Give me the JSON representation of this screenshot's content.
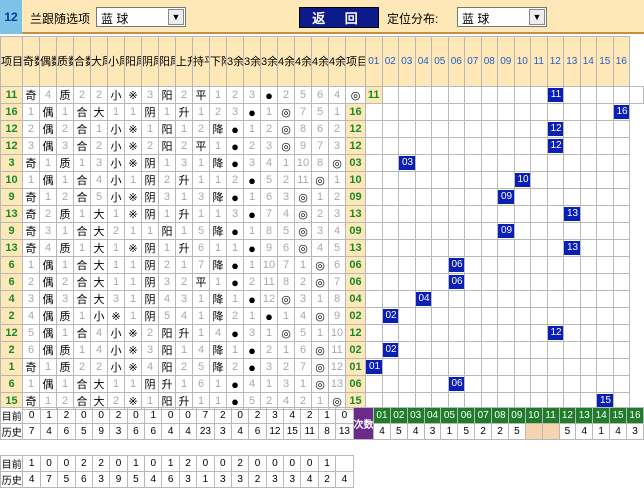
{
  "topbar": {
    "current_number": "12",
    "blue_select_label": "兰跟随选项",
    "blue_select_value": "蓝      球",
    "back_label": "返  回",
    "position_label": "定位分布:",
    "position_value": "蓝      球"
  },
  "left_headers": [
    "项目",
    "奇数",
    "偶数",
    "质数",
    "合数",
    "大尾",
    "小尾",
    "阳尾",
    "阴尾",
    "阳尾",
    "上升",
    "持平",
    "下降",
    "3余0",
    "3余1",
    "3余2",
    "4余0",
    "4余1",
    "4余2",
    "4余3",
    "项目"
  ],
  "right_headers": [
    "01",
    "02",
    "03",
    "04",
    "05",
    "06",
    "07",
    "08",
    "09",
    "10",
    "11",
    "12",
    "13",
    "14",
    "15",
    "16"
  ],
  "rows": [
    {
      "id": "11",
      "left": [
        "奇",
        "4",
        "质",
        "2",
        "2",
        "小",
        "※",
        "3",
        "阳",
        "2",
        "平",
        "1",
        "2",
        "3",
        "●",
        "2",
        "5",
        "6",
        "4",
        "◎"
      ],
      "ball": 11,
      "right_id": "11"
    },
    {
      "id": "16",
      "left": [
        "1",
        "偶",
        "1",
        "合",
        "大",
        "1",
        "1",
        "阴",
        "1",
        "升",
        "1",
        "2",
        "3",
        "●",
        "1",
        "◎",
        "7",
        "5",
        "1"
      ],
      "ball": 16,
      "right_id": "16"
    },
    {
      "id": "12",
      "left": [
        "2",
        "偶",
        "2",
        "合",
        "1",
        "小",
        "※",
        "1",
        "阳",
        "1",
        "2",
        "降",
        "●",
        "1",
        "2",
        "◎",
        "8",
        "6",
        "2"
      ],
      "ball": 12,
      "right_id": "12"
    },
    {
      "id": "12",
      "left": [
        "3",
        "偶",
        "3",
        "合",
        "2",
        "小",
        "※",
        "2",
        "阳",
        "2",
        "平",
        "1",
        "●",
        "2",
        "3",
        "◎",
        "9",
        "7",
        "3"
      ],
      "ball": 12,
      "right_id": "12"
    },
    {
      "id": "3",
      "left": [
        "奇",
        "1",
        "质",
        "1",
        "3",
        "小",
        "※",
        "阴",
        "1",
        "3",
        "1",
        "降",
        "●",
        "3",
        "4",
        "1",
        "10",
        "8",
        "◎"
      ],
      "ball": 3,
      "right_id": "03"
    },
    {
      "id": "10",
      "left": [
        "1",
        "偶",
        "1",
        "合",
        "4",
        "小",
        "1",
        "阴",
        "2",
        "升",
        "1",
        "1",
        "2",
        "●",
        "5",
        "2",
        "11",
        "◎",
        "1"
      ],
      "ball": 10,
      "right_id": "10"
    },
    {
      "id": "9",
      "left": [
        "奇",
        "1",
        "2",
        "合",
        "5",
        "小",
        "※",
        "阴",
        "3",
        "1",
        "3",
        "降",
        "●",
        "1",
        "6",
        "3",
        "◎",
        "1",
        "2"
      ],
      "ball": 9,
      "right_id": "09"
    },
    {
      "id": "13",
      "left": [
        "奇",
        "2",
        "质",
        "1",
        "大",
        "1",
        "※",
        "阴",
        "1",
        "升",
        "1",
        "1",
        "3",
        "●",
        "7",
        "4",
        "◎",
        "2",
        "3"
      ],
      "ball": 13,
      "right_id": "13"
    },
    {
      "id": "9",
      "left": [
        "奇",
        "3",
        "1",
        "合",
        "大",
        "2",
        "1",
        "1",
        "阳",
        "1",
        "5",
        "降",
        "●",
        "1",
        "8",
        "5",
        "◎",
        "3",
        "4"
      ],
      "ball": 9,
      "right_id": "09"
    },
    {
      "id": "13",
      "left": [
        "奇",
        "4",
        "质",
        "1",
        "大",
        "1",
        "※",
        "阴",
        "1",
        "升",
        "6",
        "1",
        "1",
        "●",
        "9",
        "6",
        "◎",
        "4",
        "5"
      ],
      "ball": 13,
      "right_id": "13"
    },
    {
      "id": "6",
      "left": [
        "1",
        "偶",
        "1",
        "合",
        "大",
        "1",
        "1",
        "阴",
        "2",
        "1",
        "7",
        "降",
        "●",
        "1",
        "10",
        "7",
        "1",
        "◎",
        "6"
      ],
      "ball": 6,
      "right_id": "06"
    },
    {
      "id": "6",
      "left": [
        "2",
        "偶",
        "2",
        "合",
        "大",
        "1",
        "1",
        "阴",
        "3",
        "2",
        "平",
        "1",
        "●",
        "2",
        "11",
        "8",
        "2",
        "◎",
        "7"
      ],
      "ball": 6,
      "right_id": "06"
    },
    {
      "id": "4",
      "left": [
        "3",
        "偶",
        "3",
        "合",
        "大",
        "3",
        "1",
        "阴",
        "4",
        "3",
        "1",
        "降",
        "1",
        "●",
        "12",
        "◎",
        "3",
        "1",
        "8"
      ],
      "ball": 4,
      "right_id": "04"
    },
    {
      "id": "2",
      "left": [
        "4",
        "偶",
        "质",
        "1",
        "小",
        "※",
        "1",
        "阴",
        "5",
        "4",
        "1",
        "降",
        "2",
        "1",
        "●",
        "1",
        "4",
        "◎",
        "9"
      ],
      "ball": 2,
      "right_id": "02"
    },
    {
      "id": "12",
      "left": [
        "5",
        "偶",
        "1",
        "合",
        "4",
        "小",
        "※",
        "2",
        "阳",
        "升",
        "1",
        "4",
        "●",
        "3",
        "1",
        "◎",
        "5",
        "1",
        "10"
      ],
      "ball": 12,
      "right_id": "12"
    },
    {
      "id": "2",
      "left": [
        "6",
        "偶",
        "质",
        "1",
        "4",
        "小",
        "※",
        "3",
        "阳",
        "1",
        "4",
        "降",
        "1",
        "●",
        "2",
        "1",
        "6",
        "◎",
        "11"
      ],
      "ball": 2,
      "right_id": "02"
    },
    {
      "id": "1",
      "left": [
        "奇",
        "1",
        "质",
        "2",
        "2",
        "小",
        "※",
        "4",
        "阳",
        "2",
        "5",
        "降",
        "2",
        "●",
        "3",
        "2",
        "7",
        "◎",
        "12"
      ],
      "ball": 1,
      "right_id": "01"
    },
    {
      "id": "6",
      "left": [
        "1",
        "偶",
        "1",
        "合",
        "大",
        "1",
        "1",
        "阴",
        "升",
        "1",
        "6",
        "1",
        "●",
        "4",
        "1",
        "3",
        "1",
        "◎",
        "13"
      ],
      "ball": 6,
      "right_id": "06"
    },
    {
      "id": "15",
      "left": [
        "奇",
        "1",
        "2",
        "合",
        "大",
        "2",
        "※",
        "1",
        "阳",
        "升",
        "1",
        "1",
        "●",
        "5",
        "2",
        "4",
        "2",
        "1",
        "◎"
      ],
      "ball": 15,
      "right_id": "15"
    }
  ],
  "footer": {
    "current_label": "目前",
    "history_label": "历史",
    "current_left": [
      "0",
      "1",
      "2",
      "0",
      "0",
      "2",
      "0",
      "1",
      "0",
      "0",
      "7",
      "2",
      "0",
      "2",
      "3",
      "4",
      "2",
      "1",
      "0"
    ],
    "history_left": [
      "7",
      "4",
      "6",
      "5",
      "9",
      "3",
      "6",
      "6",
      "4",
      "4",
      "23",
      "3",
      "4",
      "6",
      "12",
      "15",
      "11",
      "8",
      "13"
    ],
    "times_label": "次数",
    "nums": [
      "01",
      "02",
      "03",
      "04",
      "05",
      "06",
      "07",
      "08",
      "09",
      "10",
      "11",
      "12",
      "13",
      "14",
      "15",
      "16"
    ],
    "counts": [
      "4",
      "5",
      "4",
      "3",
      "1",
      "5",
      "2",
      "2",
      "5",
      "",
      "",
      "5",
      "4",
      "1",
      "4",
      "3"
    ],
    "current2_label": "目前",
    "history2_label": "历史",
    "current2": [
      "1",
      "0",
      "0",
      "2",
      "2",
      "0",
      "1",
      "0",
      "1",
      "2",
      "0",
      "0",
      "2",
      "0",
      "0",
      "0",
      "0",
      "1"
    ],
    "history2": [
      "4",
      "7",
      "5",
      "6",
      "3",
      "9",
      "5",
      "4",
      "6",
      "3",
      "1",
      "3",
      "3",
      "2",
      "3",
      "3",
      "4",
      "2",
      "4"
    ]
  }
}
